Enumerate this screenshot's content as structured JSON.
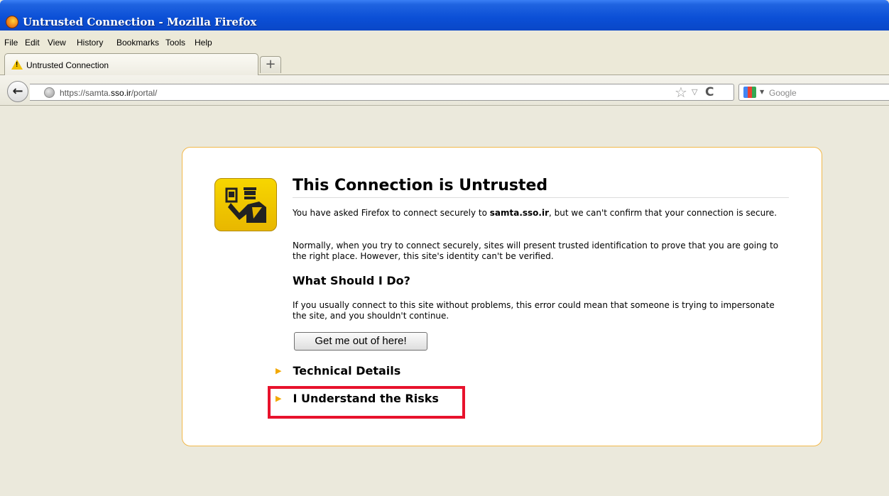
{
  "window": {
    "title": "Untrusted Connection - Mozilla Firefox"
  },
  "menu": {
    "items": [
      "File",
      "Edit",
      "View",
      "History",
      "Bookmarks",
      "Tools",
      "Help"
    ]
  },
  "tab": {
    "label": "Untrusted Connection",
    "new_tab_label": "+"
  },
  "nav": {
    "url_prefix": "https://samta.",
    "url_domain": "sso.ir",
    "url_suffix": "/portal/",
    "search_placeholder": "Google"
  },
  "error": {
    "title": "This Connection is Untrusted",
    "para1_pre": "You have asked Firefox to connect securely to ",
    "para1_host": "samta.sso.ir",
    "para1_post": ", but we can't confirm that your connection is secure.",
    "para2": "Normally, when you try to connect securely, sites will present trusted identification to prove that you are going to the right place. However, this site's identity can't be verified.",
    "subheading": "What Should I Do?",
    "para3": "If you usually connect to this site without problems, this error could mean that someone is trying to impersonate the site, and you shouldn't continue.",
    "button": "Get me out of here!",
    "technical_details": "Technical Details",
    "understand_risks": "I Understand the Risks"
  },
  "colors": {
    "highlight": "#e8122c",
    "box_border": "#f2b84a",
    "arrow": "#f2a800"
  }
}
